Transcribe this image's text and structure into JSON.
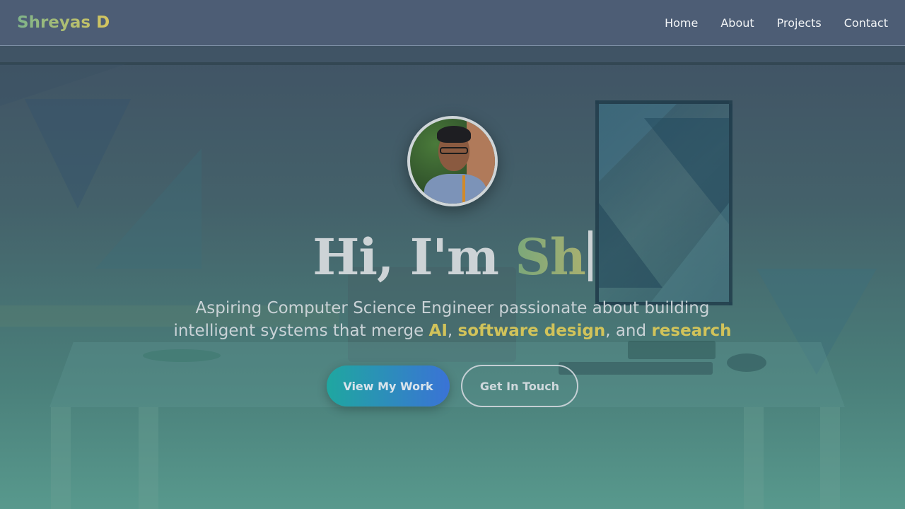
{
  "nav": {
    "brand": "Shreyas D",
    "links": [
      "Home",
      "About",
      "Projects",
      "Contact"
    ]
  },
  "hero": {
    "greeting": "Hi, I'm ",
    "typed_name": "Sh",
    "subtitle_prefix": "Aspiring Computer Science Engineer passionate about building intelligent systems that merge ",
    "highlight_1": "AI",
    "sep_1": ", ",
    "highlight_2": "software design",
    "sep_2": ", and ",
    "highlight_3": "research",
    "primary_button": "View My Work",
    "secondary_button": "Get In Touch"
  },
  "colors": {
    "accent_gold": "#d1c35a",
    "accent_green": "#7fb48a",
    "button_gradient_start": "#1fa7a0",
    "button_gradient_end": "#3a73d6"
  },
  "icons": {
    "avatar": "profile-photo"
  }
}
